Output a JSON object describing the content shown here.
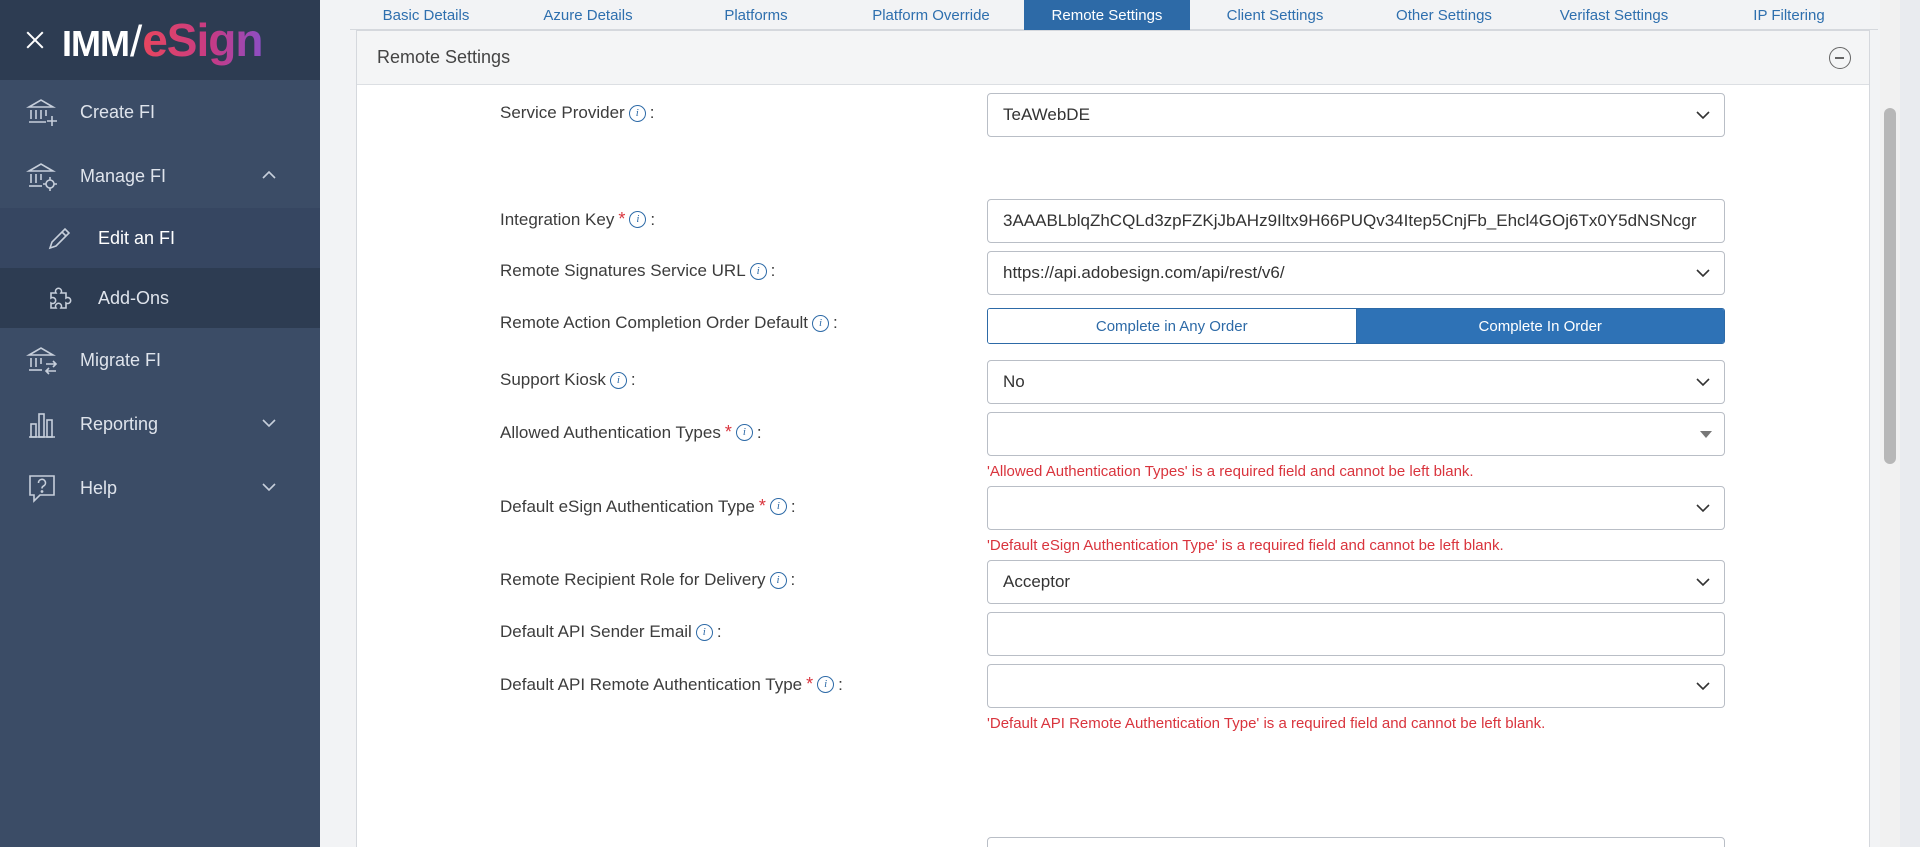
{
  "brand": {
    "imm": "IMM",
    "slash": "/",
    "esign": "eSign"
  },
  "sidebar": {
    "items": [
      {
        "label": "Create FI",
        "icon": "bank-plus-icon"
      },
      {
        "label": "Manage FI",
        "icon": "bank-gear-icon"
      },
      {
        "label": "Edit an FI",
        "icon": "pencil-icon"
      },
      {
        "label": "Add-Ons",
        "icon": "puzzle-icon"
      },
      {
        "label": "Migrate FI",
        "icon": "bank-arrows-icon"
      },
      {
        "label": "Reporting",
        "icon": "bar-chart-icon"
      },
      {
        "label": "Help",
        "icon": "help-bubble-icon"
      }
    ]
  },
  "tabs": [
    "Basic Details",
    "Azure Details",
    "Platforms",
    "Platform Override",
    "Remote Settings",
    "Client Settings",
    "Other Settings",
    "Verifast Settings",
    "IP Filtering"
  ],
  "active_tab": "Remote Settings",
  "panel": {
    "title": "Remote Settings"
  },
  "form": {
    "service_provider": {
      "label": "Service Provider",
      "value": "TeAWebDE"
    },
    "integration_key": {
      "label": "Integration Key",
      "value": "3AAABLblqZhCQLd3zpFZKjJbAHz9Iltx9H66PUQv34Itep5CnjFb_Ehcl4GOj6Tx0Y5dNSNcgr"
    },
    "service_url": {
      "label": "Remote Signatures Service URL",
      "value": "https://api.adobesign.com/api/rest/v6/"
    },
    "completion_order": {
      "label": "Remote Action Completion Order Default",
      "option_any": "Complete in Any Order",
      "option_in_order": "Complete In Order",
      "selected": "Complete In Order"
    },
    "support_kiosk": {
      "label": "Support Kiosk",
      "value": "No"
    },
    "allowed_auth": {
      "label": "Allowed Authentication Types",
      "value": "",
      "error": "'Allowed Authentication Types' is a required field and cannot be left blank."
    },
    "default_esign_auth": {
      "label": "Default eSign Authentication Type",
      "value": "",
      "error": "'Default eSign Authentication Type' is a required field and cannot be left blank."
    },
    "recipient_role": {
      "label": "Remote Recipient Role for Delivery",
      "value": "Acceptor"
    },
    "api_sender_email": {
      "label": "Default API Sender Email",
      "value": ""
    },
    "api_remote_auth": {
      "label": "Default API Remote Authentication Type",
      "value": "",
      "error": "'Default API Remote Authentication Type' is a required field and cannot be left blank."
    }
  },
  "colors": {
    "sidebar_bg": "#3b4c66",
    "sidebar_dark": "#2d3c52",
    "accent": "#2d6aa7",
    "error": "#d9343d"
  }
}
